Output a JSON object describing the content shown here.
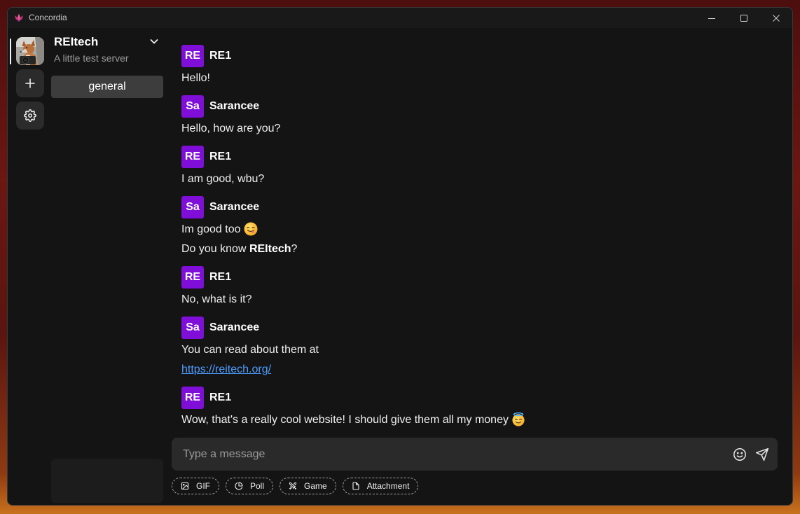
{
  "window": {
    "title": "Concordia",
    "app_icon": "concordia-logo-icon",
    "minimize_icon": "minimize-icon",
    "maximize_icon": "maximize-icon",
    "close_icon": "close-icon"
  },
  "server_rail": {
    "servers": [
      {
        "icon": "fox-avatar-image",
        "active": true
      }
    ],
    "add_server_icon": "plus-icon",
    "settings_icon": "gear-icon"
  },
  "server": {
    "name": "REItech",
    "description": "A little test server",
    "menu_icon": "chevron-down-icon"
  },
  "channels": [
    {
      "name": "general",
      "selected": true
    }
  ],
  "messages": [
    {
      "author": "RE1",
      "initials": "RE",
      "lines": [
        [
          {
            "text": "Hello!"
          }
        ]
      ]
    },
    {
      "author": "Sarancee",
      "initials": "Sa",
      "lines": [
        [
          {
            "text": "Hello, how are you?"
          }
        ]
      ]
    },
    {
      "author": "RE1",
      "initials": "RE",
      "lines": [
        [
          {
            "text": "I am good, wbu?"
          }
        ]
      ]
    },
    {
      "author": "Sarancee",
      "initials": "Sa",
      "lines": [
        [
          {
            "text": "Im good too"
          },
          {
            "emoji": "face-savoring-food-emoji"
          }
        ],
        [
          {
            "text": "Do you know "
          },
          {
            "text": "REItech",
            "bold": true
          },
          {
            "text": "?"
          }
        ]
      ]
    },
    {
      "author": "RE1",
      "initials": "RE",
      "lines": [
        [
          {
            "text": "No, what is it?"
          }
        ]
      ]
    },
    {
      "author": "Sarancee",
      "initials": "Sa",
      "lines": [
        [
          {
            "text": "You can read about them at"
          }
        ],
        [
          {
            "text": "https://reitech.org/",
            "link": true
          }
        ]
      ]
    },
    {
      "author": "RE1",
      "initials": "RE",
      "lines": [
        [
          {
            "text": "Wow, that's a really cool website! I should give them all my money"
          },
          {
            "emoji": "smiling-face-with-halo-emoji"
          }
        ]
      ]
    }
  ],
  "composer": {
    "placeholder": "Type a message",
    "emoji_icon": "smiley-icon",
    "send_icon": "send-icon"
  },
  "composer_actions": [
    {
      "label": "GIF",
      "icon": "image-icon"
    },
    {
      "label": "Poll",
      "icon": "pie-chart-icon"
    },
    {
      "label": "Game",
      "icon": "crossed-swords-icon"
    },
    {
      "label": "Attachment",
      "icon": "file-icon"
    }
  ],
  "colors": {
    "avatar_accent": "#7e0ed8",
    "link": "#4d9dff",
    "window_background": "#141414",
    "selected_channel": "#3d3d3d",
    "composer_background": "#2a2a2a",
    "button_background": "#2b2b2b"
  }
}
